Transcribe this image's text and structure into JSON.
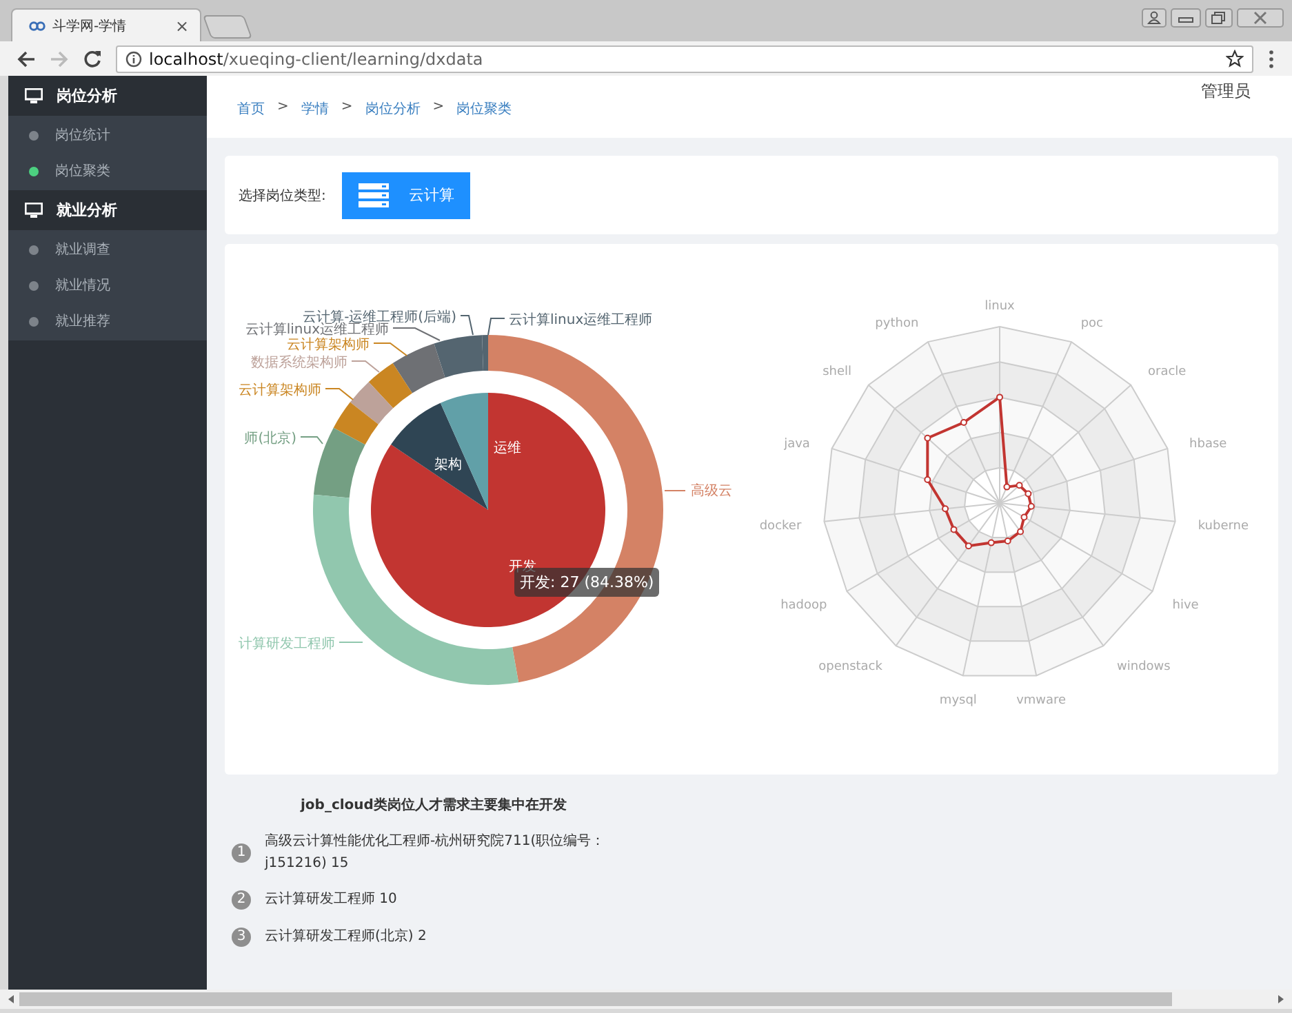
{
  "browser": {
    "tab_title": "斗学网-学情",
    "tab_close": "×",
    "url_host": "localhost",
    "url_path": "/xueqing-client/learning/dxdata"
  },
  "sidebar": {
    "groups": [
      {
        "title": "岗位分析",
        "items": [
          {
            "label": "岗位统计",
            "selected": false
          },
          {
            "label": "岗位聚类",
            "selected": true
          }
        ]
      },
      {
        "title": "就业分析",
        "items": [
          {
            "label": "就业调查",
            "selected": false
          },
          {
            "label": "就业情况",
            "selected": false
          },
          {
            "label": "就业推荐",
            "selected": false
          }
        ]
      }
    ]
  },
  "header": {
    "user": "管理员",
    "breadcrumb": [
      "首页",
      "学情",
      "岗位分析",
      "岗位聚类"
    ],
    "separator": ">"
  },
  "selector": {
    "label": "选择岗位类型:",
    "options": [
      {
        "label": "云计算",
        "selected": true
      }
    ]
  },
  "donut": {
    "inner": [
      {
        "label": "开发",
        "color": "#c23531"
      },
      {
        "label": "架构",
        "color": "#2f4554"
      },
      {
        "label": "运维",
        "color": "#61a0a8"
      }
    ],
    "outer": [
      {
        "label": "云计算-运维工程师(后端)",
        "color": "#546570"
      },
      {
        "label": "云计算linux运维工程师",
        "color": "#546570"
      },
      {
        "label": "云计算linux运维工程师",
        "color": "#6e7074"
      },
      {
        "label": "云计算架构师",
        "color": "#ca8622"
      },
      {
        "label": "数据系统架构师",
        "color": "#bda29a"
      },
      {
        "label": "云计算架构师",
        "color": "#ca8622"
      },
      {
        "label": "师(北京)",
        "color": "#749f83"
      },
      {
        "label": "高级云",
        "color": "#d48265"
      },
      {
        "label": "计算研发工程师",
        "color": "#91c7ae"
      }
    ],
    "tooltip": "开发: 27 (84.38%)"
  },
  "radar": {
    "axes": [
      "linux",
      "poc",
      "oracle",
      "hbase",
      "kuberne",
      "hive",
      "windows",
      "vmware",
      "mysql",
      "openstack",
      "hadoop",
      "docker",
      "java",
      "shell",
      "python"
    ]
  },
  "summary": {
    "title": "job_cloud类岗位人才需求主要集中在开发",
    "ranking": [
      {
        "rank": "1",
        "text": "高级云计算性能优化工程师-杭州研究院711(职位编号：j151216)  15"
      },
      {
        "rank": "2",
        "text": "云计算研发工程师  10"
      },
      {
        "rank": "3",
        "text": "云计算研发工程师(北京)  2"
      }
    ]
  }
}
